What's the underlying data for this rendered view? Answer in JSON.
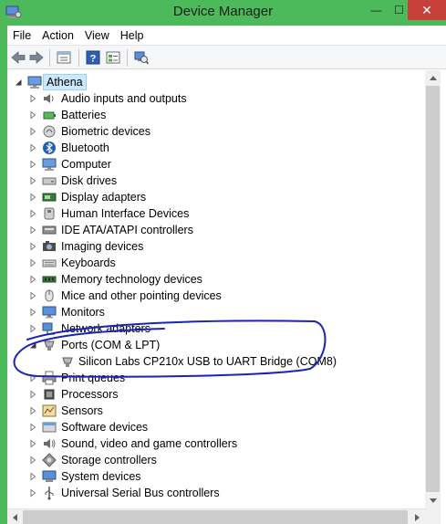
{
  "window": {
    "title": "Device Manager",
    "minimize_glyph": "—",
    "maximize_glyph": "☐",
    "close_glyph": "✕",
    "accent": "#4cba5b",
    "close_color": "#c7403a"
  },
  "menu": [
    "File",
    "Action",
    "View",
    "Help"
  ],
  "toolbar": {
    "icons": [
      "back-arrow-icon",
      "forward-arrow-icon",
      "properties-sheet-icon",
      "help-icon",
      "view-details-icon",
      "scan-hardware-icon"
    ]
  },
  "tree": {
    "root": "Athena",
    "items": [
      {
        "label": "Audio inputs and outputs",
        "icon": "speaker-icon",
        "expanded": false
      },
      {
        "label": "Batteries",
        "icon": "battery-icon",
        "expanded": false
      },
      {
        "label": "Biometric devices",
        "icon": "biometric-icon",
        "expanded": false
      },
      {
        "label": "Bluetooth",
        "icon": "bluetooth-icon",
        "expanded": false
      },
      {
        "label": "Computer",
        "icon": "computer-icon",
        "expanded": false
      },
      {
        "label": "Disk drives",
        "icon": "disk-drive-icon",
        "expanded": false
      },
      {
        "label": "Display adapters",
        "icon": "display-adapter-icon",
        "expanded": false
      },
      {
        "label": "Human Interface Devices",
        "icon": "hid-icon",
        "expanded": false
      },
      {
        "label": "IDE ATA/ATAPI controllers",
        "icon": "ide-controller-icon",
        "expanded": false
      },
      {
        "label": "Imaging devices",
        "icon": "camera-icon",
        "expanded": false
      },
      {
        "label": "Keyboards",
        "icon": "keyboard-icon",
        "expanded": false
      },
      {
        "label": "Memory technology devices",
        "icon": "memory-icon",
        "expanded": false
      },
      {
        "label": "Mice and other pointing devices",
        "icon": "mouse-icon",
        "expanded": false
      },
      {
        "label": "Monitors",
        "icon": "monitor-icon",
        "expanded": false
      },
      {
        "label": "Network adapters",
        "icon": "network-adapter-icon",
        "expanded": false
      },
      {
        "label": "Ports (COM & LPT)",
        "icon": "port-icon",
        "expanded": true,
        "children": [
          {
            "label": "Silicon Labs CP210x USB to UART Bridge (COM8)",
            "icon": "port-icon"
          }
        ]
      },
      {
        "label": "Print queues",
        "icon": "printer-icon",
        "expanded": false
      },
      {
        "label": "Processors",
        "icon": "processor-icon",
        "expanded": false
      },
      {
        "label": "Sensors",
        "icon": "sensor-icon",
        "expanded": false
      },
      {
        "label": "Software devices",
        "icon": "software-device-icon",
        "expanded": false
      },
      {
        "label": "Sound, video and game controllers",
        "icon": "sound-icon",
        "expanded": false
      },
      {
        "label": "Storage controllers",
        "icon": "storage-controller-icon",
        "expanded": false
      },
      {
        "label": "System devices",
        "icon": "system-device-icon",
        "expanded": false
      },
      {
        "label": "Universal Serial Bus controllers",
        "icon": "usb-icon",
        "expanded": false
      }
    ]
  },
  "annotation": {
    "color": "#1a23b8"
  }
}
